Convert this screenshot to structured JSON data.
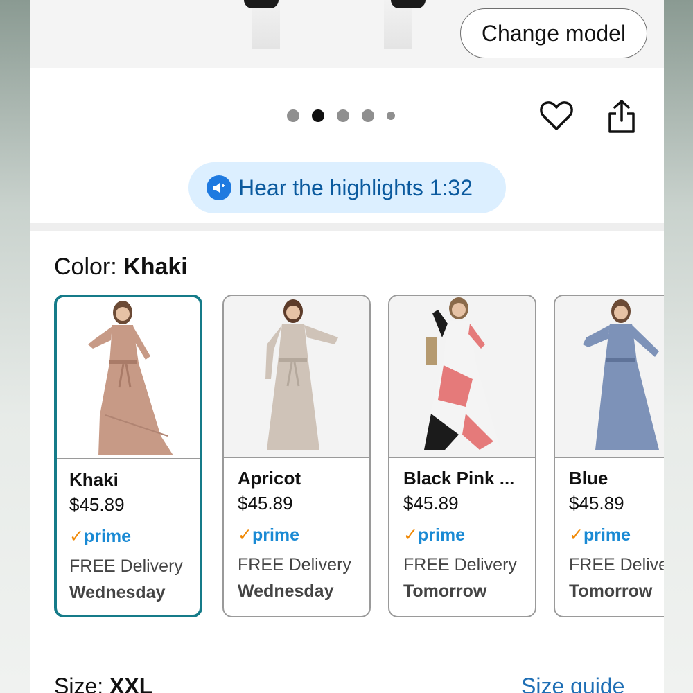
{
  "hero": {
    "change_model_label": "Change model"
  },
  "carousel": {
    "dots": 5,
    "active_index": 1
  },
  "actions": {
    "favorite_icon": "heart-icon",
    "share_icon": "share-icon"
  },
  "audio": {
    "label": "Hear the highlights 1:32",
    "icon": "speaker-icon"
  },
  "color": {
    "prefix": "Color: ",
    "selected": "Khaki"
  },
  "variants": [
    {
      "name": "Khaki",
      "price": "$45.89",
      "prime_check": "✓",
      "prime": "prime",
      "delivery": "FREE Delivery",
      "day": "Wednesday",
      "selected": true
    },
    {
      "name": "Apricot",
      "price": "$45.89",
      "prime_check": "✓",
      "prime": "prime",
      "delivery": "FREE Delivery",
      "day": "Wednesday",
      "selected": false
    },
    {
      "name": "Black Pink ...",
      "price": "$45.89",
      "prime_check": "✓",
      "prime": "prime",
      "delivery": "FREE Delivery",
      "day": "Tomorrow",
      "selected": false
    },
    {
      "name": "Blue",
      "price": "$45.89",
      "prime_check": "✓",
      "prime": "prime",
      "delivery": "FREE Delive",
      "day": "Tomorrow",
      "selected": false
    }
  ],
  "size": {
    "prefix": "Size: ",
    "selected": "XXL",
    "guide_label": "Size guide"
  },
  "colors": {
    "selected_border": "#157b89",
    "prime_blue": "#1a8ad4",
    "prime_check": "#f08804",
    "link_blue": "#1f6fb5",
    "audio_bg": "#dcefff"
  }
}
